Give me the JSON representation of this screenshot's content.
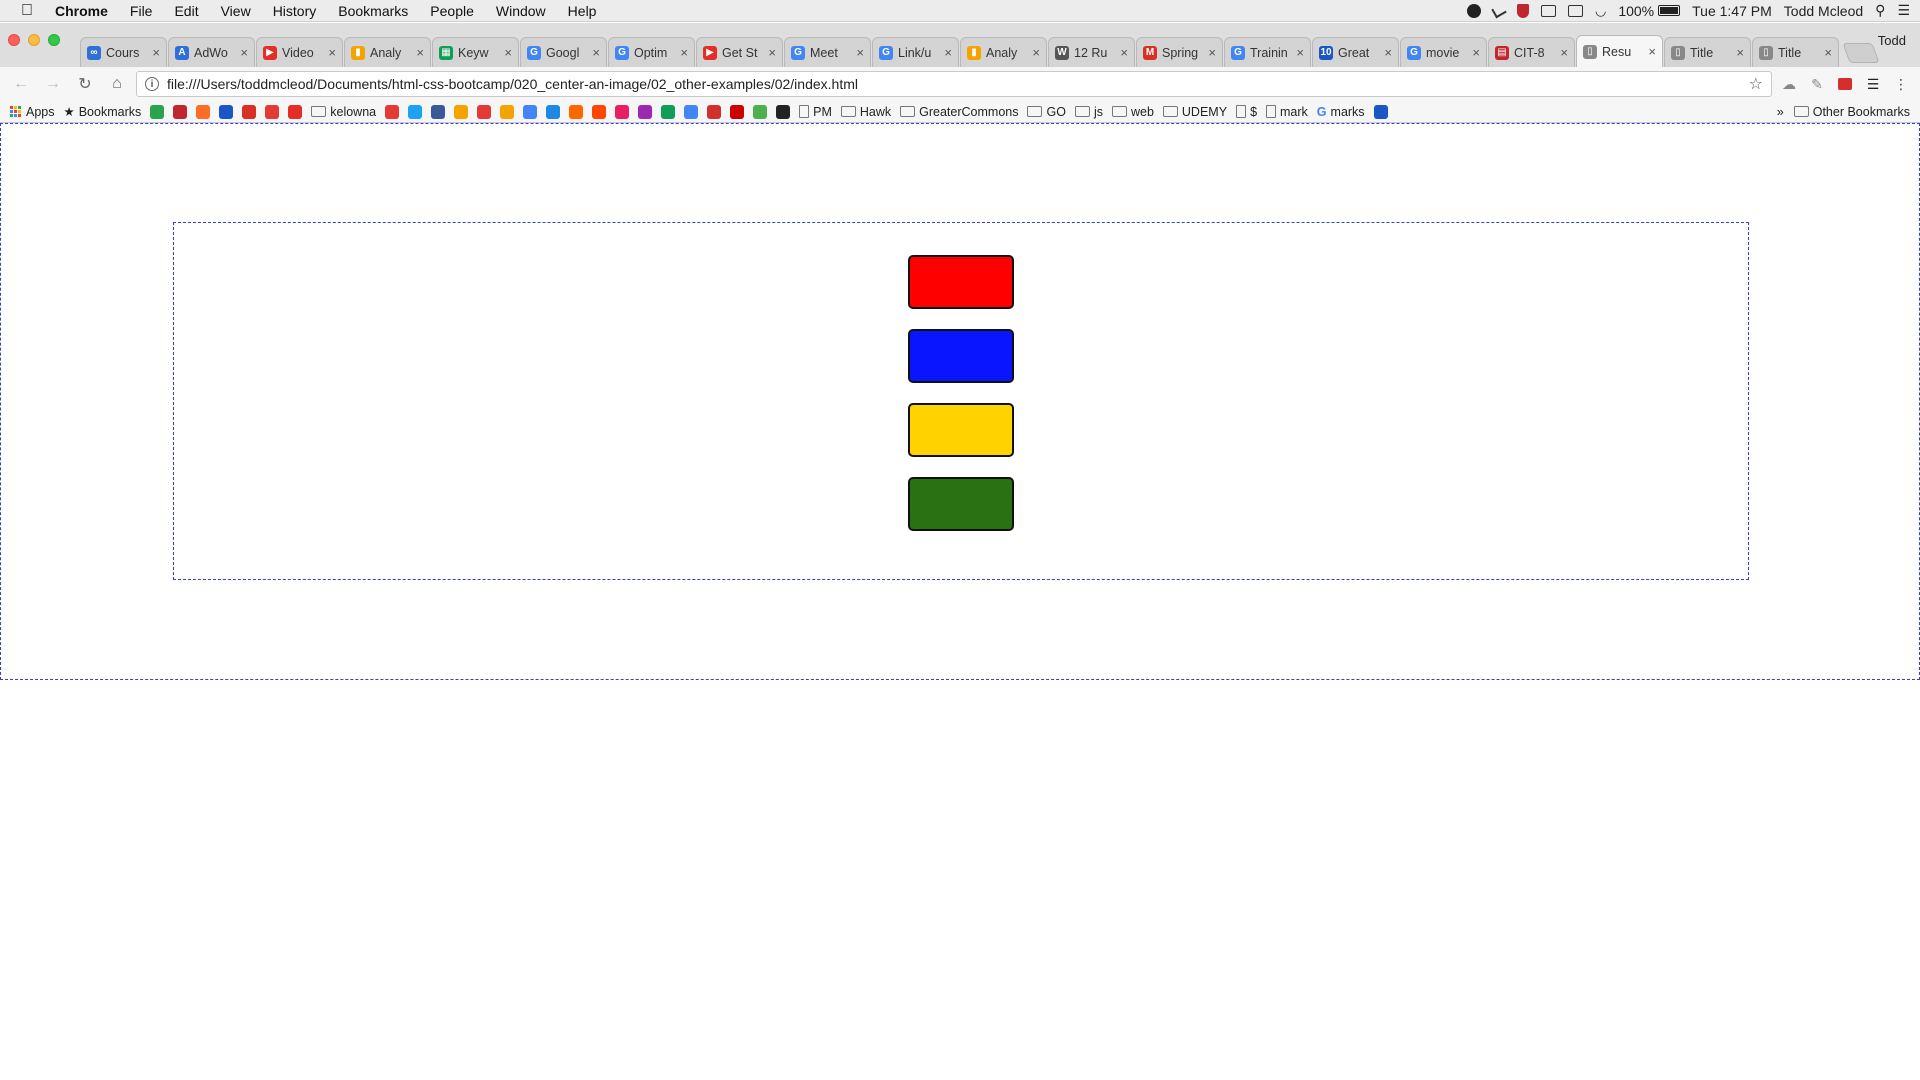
{
  "menubar": {
    "app_name": "Chrome",
    "items": [
      "File",
      "Edit",
      "View",
      "History",
      "Bookmarks",
      "People",
      "Window",
      "Help"
    ],
    "battery": "100%",
    "clock": "Tue 1:47 PM",
    "user": "Todd Mcleod"
  },
  "tabs": [
    {
      "label": "Cours",
      "color": "#2f6fd6",
      "glyph": "∞"
    },
    {
      "label": "AdWo",
      "color": "#2f6fd6",
      "glyph": "A"
    },
    {
      "label": "Video",
      "color": "#e52d27",
      "glyph": "▶"
    },
    {
      "label": "Analy",
      "color": "#f4a300",
      "glyph": "▮"
    },
    {
      "label": "Keyw",
      "color": "#0f9d58",
      "glyph": "▦"
    },
    {
      "label": "Googl",
      "color": "#4285f4",
      "glyph": "G"
    },
    {
      "label": "Optim",
      "color": "#4285f4",
      "glyph": "G"
    },
    {
      "label": "Get St",
      "color": "#e52d27",
      "glyph": "▶"
    },
    {
      "label": "Meet",
      "color": "#4285f4",
      "glyph": "G"
    },
    {
      "label": "Link/u",
      "color": "#4285f4",
      "glyph": "G"
    },
    {
      "label": "Analy",
      "color": "#f4a300",
      "glyph": "▮"
    },
    {
      "label": "12 Ru",
      "color": "#555555",
      "glyph": "W"
    },
    {
      "label": "Spring",
      "color": "#d93025",
      "glyph": "M"
    },
    {
      "label": "Trainin",
      "color": "#4285f4",
      "glyph": "G"
    },
    {
      "label": "Great",
      "color": "#1a56c4",
      "glyph": "10"
    },
    {
      "label": "movie",
      "color": "#4285f4",
      "glyph": "G"
    },
    {
      "label": "CIT-8",
      "color": "#c0262e",
      "glyph": "▤"
    },
    {
      "label": "Resu",
      "color": "#888888",
      "glyph": "▯",
      "active": true
    },
    {
      "label": "Title",
      "color": "#888888",
      "glyph": "▯"
    },
    {
      "label": "Title",
      "color": "#888888",
      "glyph": "▯"
    }
  ],
  "tab_close_glyph": "×",
  "profile_name": "Todd",
  "toolbar": {
    "back": "←",
    "forward": "→",
    "reload": "↻",
    "home": "⌂",
    "info": "i",
    "url": "file:///Users/toddmcleod/Documents/html-css-bootcamp/020_center-an-image/02_other-examples/02/index.html",
    "star": "☆"
  },
  "bookmarks": {
    "apps_label": "Apps",
    "bookmarks_label": "Bookmarks",
    "folders": [
      "kelowna",
      "PM",
      "Hawk",
      "GreaterCommons",
      "GO",
      "js",
      "web",
      "UDEMY",
      "$",
      "mark",
      "marks"
    ],
    "overflow": "»",
    "other_label": "Other Bookmarks",
    "icon_colors": [
      "#2ba24c",
      "#c0262e",
      "#fc6d26",
      "#1a56c4",
      "#d93025",
      "#e53935",
      "#e52d27",
      "#e53935",
      "#1da1f2",
      "#3b5998",
      "#f4a300",
      "#e53935",
      "#f4a300",
      "#4285f4",
      "#1e88e5",
      "#ff6600",
      "#ff4500",
      "#e91e63",
      "#9c27b0",
      "#0f9d58",
      "#4285f4",
      "#d32f2f",
      "#cc0000",
      "#4caf50",
      "#222222",
      "#1a56c4"
    ]
  },
  "page": {
    "blocks": [
      {
        "name": "red-block",
        "color": "#ff0000"
      },
      {
        "name": "blue-block",
        "color": "#0a15ff"
      },
      {
        "name": "yellow-block",
        "color": "#ffd200"
      },
      {
        "name": "green-block",
        "color": "#2a7114"
      }
    ]
  }
}
